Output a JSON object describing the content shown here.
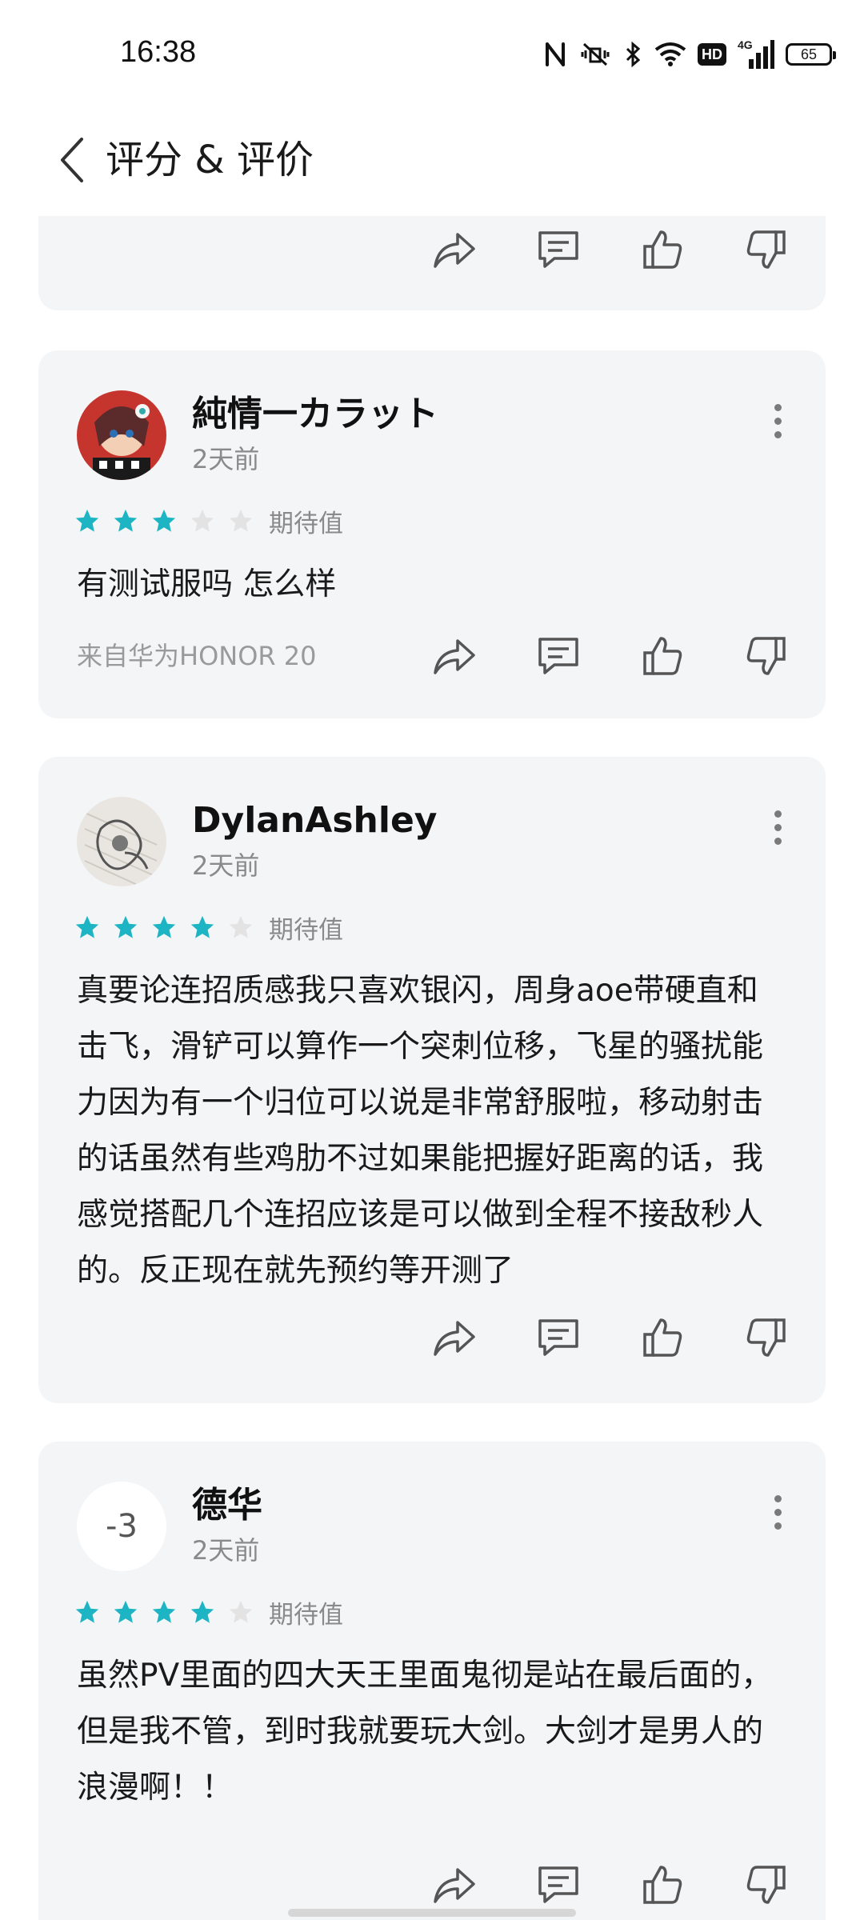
{
  "status_bar": {
    "time": "16:38",
    "icons": [
      "nfc-icon",
      "mute-vibrate-icon",
      "bluetooth-icon",
      "wifi-icon",
      "hd-icon",
      "signal-4g-icon",
      "battery-icon"
    ],
    "hd_label": "HD",
    "network_label": "4G",
    "battery_level": "65"
  },
  "header": {
    "back_icon": "chevron-left-icon",
    "title": "评分 & 评价"
  },
  "accent_color": "#1db5c4",
  "reviews": [
    {
      "username": "純情一カラット",
      "date": "2天前",
      "rating": 3,
      "rating_label": "期待值",
      "text": "有测试服吗 怎么样",
      "device": "来自华为HONOR 20",
      "avatar": "anime-avatar"
    },
    {
      "username": "DylanAshley",
      "date": "2天前",
      "rating": 4,
      "rating_label": "期待值",
      "text": "真要论连招质感我只喜欢银闪，周身aoe带硬直和击飞，滑铲可以算作一个突刺位移，飞星的骚扰能力因为有一个归位可以说是非常舒服啦，移动射击的话虽然有些鸡肋不过如果能把握好距离的话，我感觉搭配几个连招应该是可以做到全程不接敌秒人的。反正现在就先预约等开测了",
      "avatar": "sketch-avatar"
    },
    {
      "username": "德华",
      "date": "2天前",
      "rating": 4,
      "rating_label": "期待值",
      "avatar_text": "-3",
      "text": "虽然PV里面的四大天王里面鬼彻是站在最后面的，但是我不管，到时我就要玩大剑。大剑才是男人的浪漫啊！！"
    }
  ],
  "actions": [
    "share-icon",
    "comment-icon",
    "thumbs-up-icon",
    "thumbs-down-icon"
  ]
}
